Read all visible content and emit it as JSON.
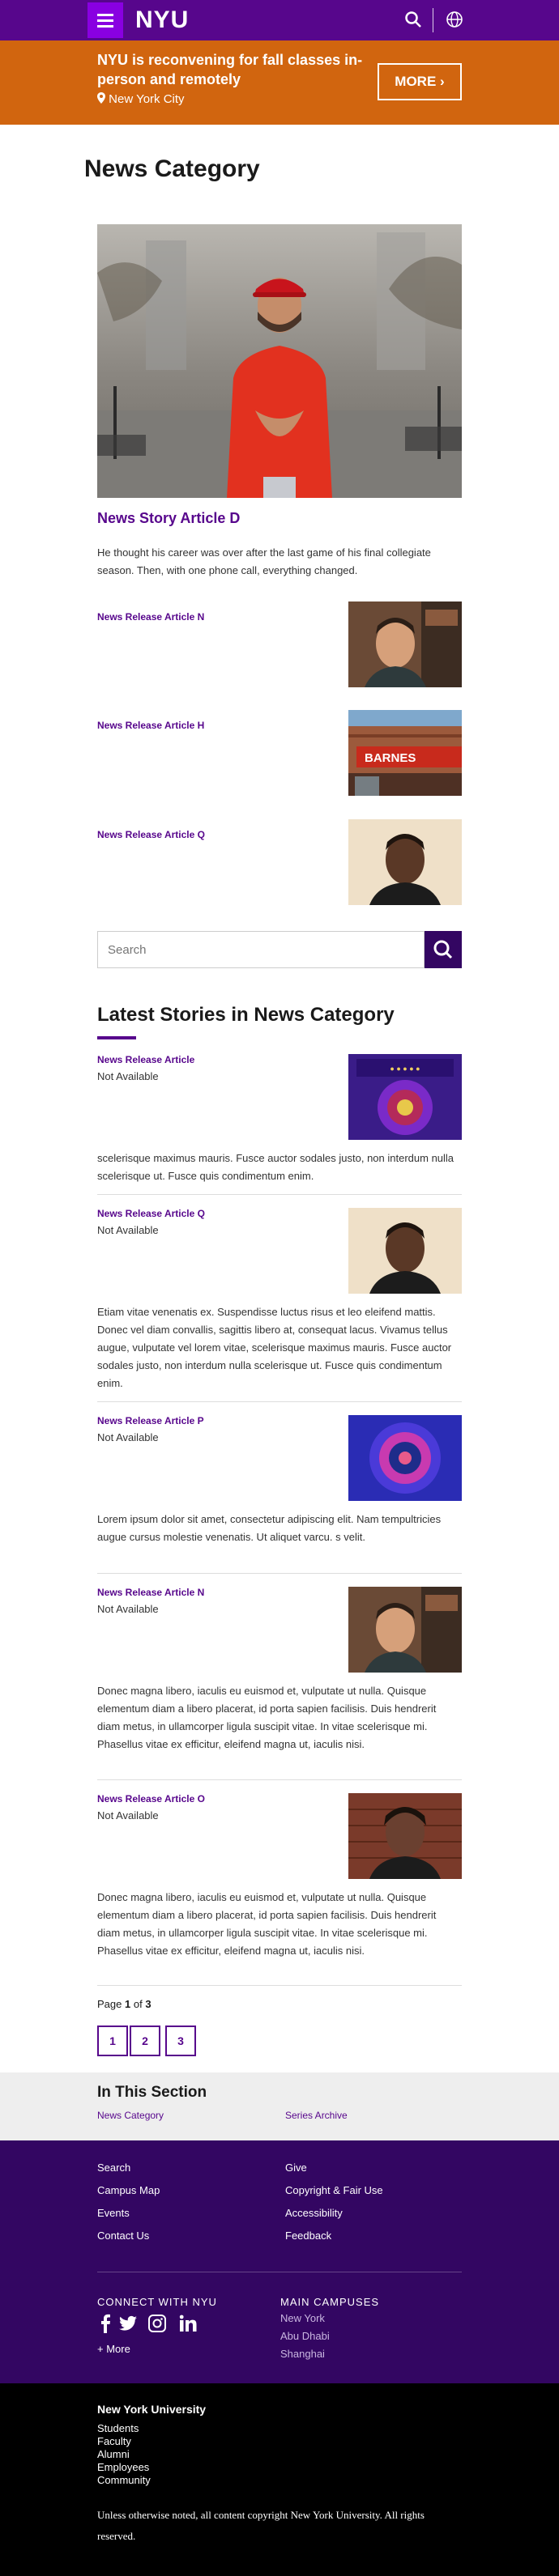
{
  "header": {
    "logo": "NYU",
    "menu_icon": "hamburger-icon",
    "search_icon": "search-icon",
    "globe_icon": "globe-icon"
  },
  "banner": {
    "text": "NYU is reconvening for fall classes in-person and remotely",
    "location": "New York City",
    "more_label": "MORE ›"
  },
  "page_title": "News Category",
  "featured": {
    "title": "News Story Article D",
    "description": "He thought his career was over after the last game of his final collegiate season. Then, with one phone call, everything changed."
  },
  "releases": [
    {
      "title": "News Release Article N"
    },
    {
      "title": "News Release Article H"
    },
    {
      "title": "News Release Article Q"
    }
  ],
  "search": {
    "placeholder": "Search"
  },
  "latest": {
    "heading": "Latest Stories in News Category",
    "items": [
      {
        "title": "News Release Article",
        "status": "Not Available",
        "desc": "scelerisque maximus mauris. Fusce auctor sodales justo, non interdum nulla scelerisque ut. Fusce quis condimentum enim."
      },
      {
        "title": "News Release Article Q",
        "status": "Not Available",
        "desc": "Etiam vitae venenatis ex. Suspendisse luctus risus et leo eleifend mattis. Donec vel diam convallis, sagittis libero at, consequat lacus. Vivamus tellus augue, vulputate vel lorem vitae, scelerisque maximus mauris. Fusce auctor sodales justo, non interdum nulla scelerisque ut. Fusce quis condimentum enim."
      },
      {
        "title": "News Release Article P",
        "status": "Not Available",
        "desc": "Lorem ipsum dolor sit amet, consectetur adipiscing elit. Nam tempultricies augue cursus molestie venenatis. Ut aliquet varcu. s velit."
      },
      {
        "title": "News Release Article N",
        "status": "Not Available",
        "desc": "Donec magna libero, iaculis eu euismod et, vulputate ut nulla. Quisque elementum diam a libero placerat, id porta sapien facilisis. Duis hendrerit diam metus, in ullamcorper ligula suscipit vitae. In vitae scelerisque mi. Phasellus vitae ex efficitur, eleifend magna ut, iaculis nisi."
      },
      {
        "title": "News Release Article O",
        "status": "Not Available",
        "desc": "Donec magna libero, iaculis eu euismod et, vulputate ut nulla. Quisque elementum diam a libero placerat, id porta sapien facilisis. Duis hendrerit diam metus, in ullamcorper ligula suscipit vitae. In vitae scelerisque mi. Phasellus vitae ex efficitur, eleifend magna ut, iaculis nisi."
      }
    ]
  },
  "pagination": {
    "label": "Page",
    "current": "1",
    "of": "of",
    "total": "3",
    "pages": [
      "1",
      "2",
      "3"
    ]
  },
  "section": {
    "heading": "In This Section",
    "links": [
      "News Category",
      "Series Archive"
    ]
  },
  "footer": {
    "col1": [
      "Search",
      "Campus Map",
      "Events",
      "Contact Us"
    ],
    "col2": [
      "Give",
      "Copyright & Fair Use",
      "Accessibility",
      "Feedback"
    ],
    "connect_heading": "CONNECT WITH NYU",
    "more": "+ More",
    "campuses_heading": "MAIN CAMPUSES",
    "campuses": [
      "New York",
      "Abu Dhabi",
      "Shanghai"
    ],
    "social_icons": [
      "facebook-icon",
      "twitter-icon",
      "instagram-icon",
      "linkedin-icon"
    ]
  },
  "bottom": {
    "heading": "New York University",
    "links": [
      "Students",
      "Faculty",
      "Alumni",
      "Employees",
      "Community"
    ],
    "copyright": "Unless otherwise noted, all content copyright New York University. All rights reserved."
  },
  "colors": {
    "brand": "#57068c",
    "accent": "#8900e1",
    "banner": "#d1650f",
    "footer": "#330662"
  }
}
